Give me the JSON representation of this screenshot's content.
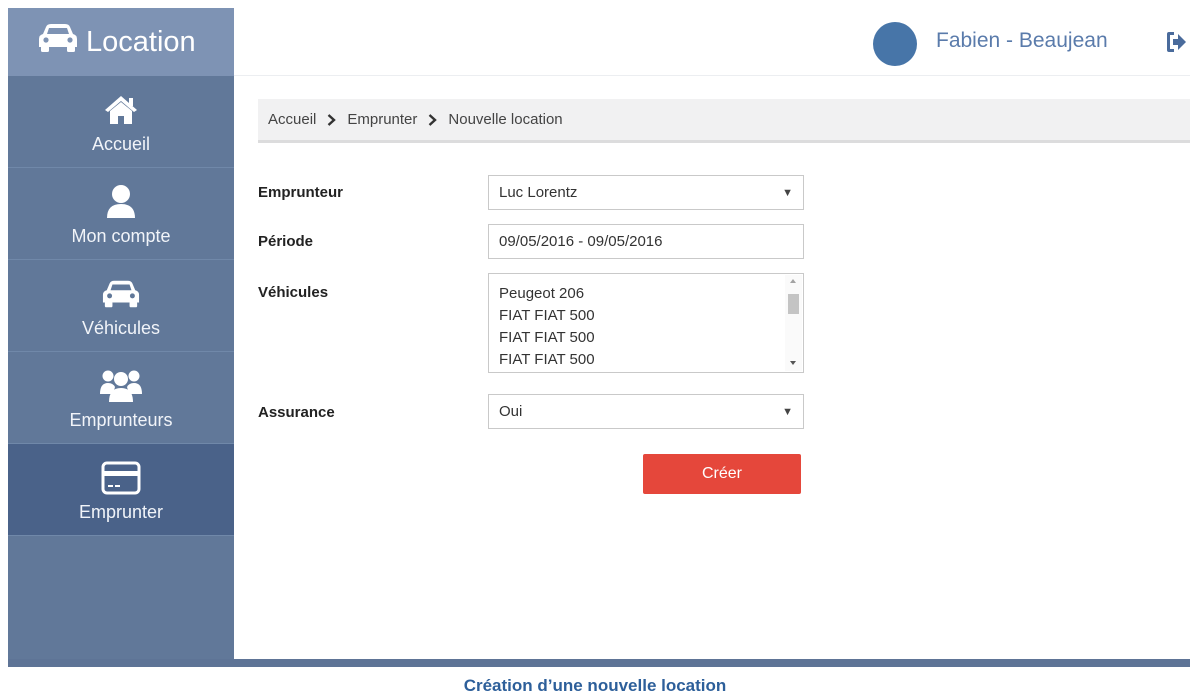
{
  "app": {
    "title": "Location"
  },
  "sidebar": {
    "items": [
      {
        "label": "Accueil",
        "icon": "home-icon",
        "active": false
      },
      {
        "label": "Mon compte",
        "icon": "user-icon",
        "active": false
      },
      {
        "label": "Véhicules",
        "icon": "car-icon",
        "active": false
      },
      {
        "label": "Emprunteurs",
        "icon": "users-icon",
        "active": false
      },
      {
        "label": "Emprunter",
        "icon": "credit-card-icon",
        "active": true
      }
    ]
  },
  "header": {
    "user_name": "Fabien - Beaujean",
    "avatar_color": "#4775a8",
    "logout_icon": "sign-out-icon"
  },
  "breadcrumb": [
    "Accueil",
    "Emprunter",
    "Nouvelle location"
  ],
  "form": {
    "emprunteur": {
      "label": "Emprunteur",
      "value": "Luc Lorentz"
    },
    "periode": {
      "label": "Période",
      "value": "09/05/2016 - 09/05/2016"
    },
    "vehicules": {
      "label": "Véhicules",
      "options": [
        "Peugeot 206",
        "FIAT FIAT 500",
        "FIAT FIAT 500",
        "FIAT FIAT 500"
      ]
    },
    "assurance": {
      "label": "Assurance",
      "value": "Oui"
    },
    "submit_label": "Créer"
  },
  "caption": "Création d’une nouvelle location",
  "colors": {
    "sidebar": "#617899",
    "sidebar_active": "#4a6289",
    "brand": "#7e93b4",
    "accent": "#5a7bab",
    "submit": "#e5473b",
    "caption": "#2d5f9a"
  }
}
